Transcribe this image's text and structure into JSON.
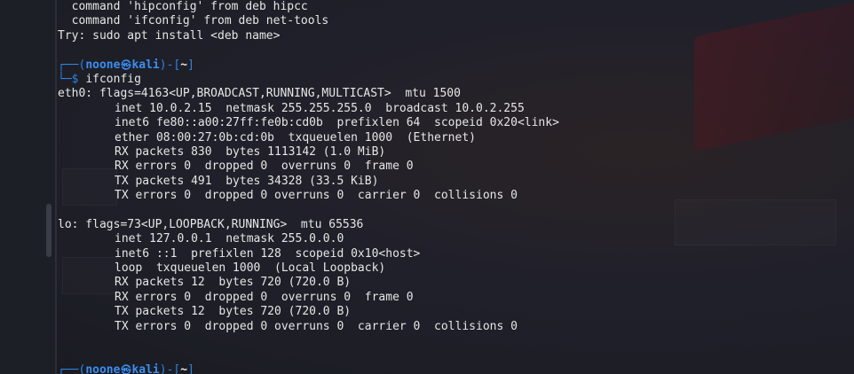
{
  "terminal": {
    "header_lines": [
      "  command 'hipconfig' from deb hipcc",
      "  command 'ifconfig' from deb net-tools",
      "Try: sudo apt install <deb name>"
    ],
    "prompt": {
      "frame_top_left": "┌──(",
      "user": "noone",
      "at_symbol": "㉿",
      "host": "kali",
      "frame_mid": ")-[",
      "dir": "~",
      "frame_close": "]",
      "frame_bottom": "└─",
      "dollar": "$"
    },
    "command": "ifconfig",
    "eth0": {
      "header": "eth0: flags=4163<UP,BROADCAST,RUNNING,MULTICAST>  mtu 1500",
      "lines": [
        "inet 10.0.2.15  netmask 255.255.255.0  broadcast 10.0.2.255",
        "inet6 fe80::a00:27ff:fe0b:cd0b  prefixlen 64  scopeid 0x20<link>",
        "ether 08:00:27:0b:cd:0b  txqueuelen 1000  (Ethernet)",
        "RX packets 830  bytes 1113142 (1.0 MiB)",
        "RX errors 0  dropped 0  overruns 0  frame 0",
        "TX packets 491  bytes 34328 (33.5 KiB)",
        "TX errors 0  dropped 0 overruns 0  carrier 0  collisions 0"
      ]
    },
    "lo": {
      "header": "lo: flags=73<UP,LOOPBACK,RUNNING>  mtu 65536",
      "lines": [
        "inet 127.0.0.1  netmask 255.0.0.0",
        "inet6 ::1  prefixlen 128  scopeid 0x10<host>",
        "loop  txqueuelen 1000  (Local Loopback)",
        "RX packets 12  bytes 720 (720.0 B)",
        "RX errors 0  dropped 0  overruns 0  frame 0",
        "TX packets 12  bytes 720 (720.0 B)",
        "TX errors 0  dropped 0 overruns 0  carrier 0  collisions 0"
      ]
    }
  },
  "colors": {
    "prompt_blue": "#3b8ef2",
    "text": "#e6e6e6",
    "background": "#1b1d23"
  }
}
